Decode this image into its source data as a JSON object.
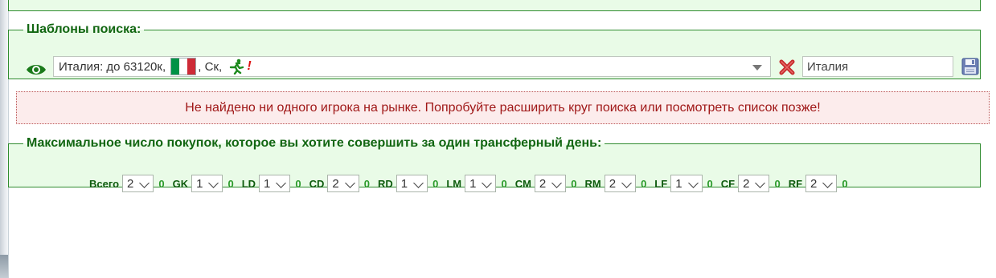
{
  "search_templates": {
    "legend": "Шаблоны поиска:",
    "selected_template": {
      "text_before_flag": "Италия: до 63120к, ",
      "flag_colors": [
        "#009246",
        "#ffffff",
        "#ce2b37"
      ],
      "text_after_flag": ", Ск, ",
      "runner_icon": "running-player-icon",
      "exclamation": "!"
    },
    "name_input_value": "Италия",
    "icons": {
      "visibility": "eye-icon",
      "delete": "red-x-icon",
      "save": "floppy-disk-icon"
    }
  },
  "alert": {
    "message": "Не найдено ни одного игрока на рынке. Попробуйте расширить круг поиска или посмотреть список позже!"
  },
  "purchase_limits": {
    "legend": "Максимальное число покупок, которое вы хотите совершить за один трансферный день:",
    "items": [
      {
        "label": "Всего",
        "value": "2",
        "count": "0"
      },
      {
        "label": "GK",
        "value": "1",
        "count": "0"
      },
      {
        "label": "LD",
        "value": "1",
        "count": "0"
      },
      {
        "label": "CD",
        "value": "2",
        "count": "0"
      },
      {
        "label": "RD",
        "value": "1",
        "count": "0"
      },
      {
        "label": "LM",
        "value": "1",
        "count": "0"
      },
      {
        "label": "CM",
        "value": "2",
        "count": "0"
      },
      {
        "label": "RM",
        "value": "2",
        "count": "0"
      },
      {
        "label": "LF",
        "value": "1",
        "count": "0"
      },
      {
        "label": "CF",
        "value": "2",
        "count": "0"
      },
      {
        "label": "RF",
        "value": "2",
        "count": "0"
      }
    ]
  },
  "colors": {
    "panel_bg": "#e9fbe7",
    "panel_border": "#2e8b2e",
    "legend_text": "#116611",
    "alert_bg": "#fcecec",
    "alert_text": "#a01818",
    "count_text": "#2a9a2a"
  }
}
